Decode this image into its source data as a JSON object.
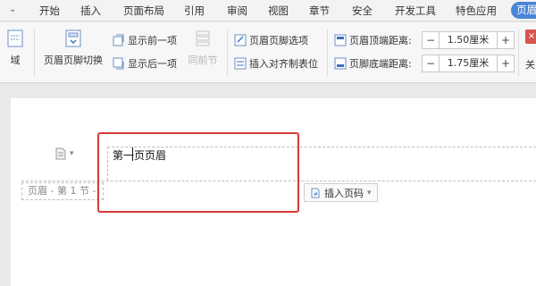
{
  "menubar": {
    "dropdown_icon": "chevron-down-icon",
    "tabs": [
      "开始",
      "插入",
      "页面布局",
      "引用",
      "审阅",
      "视图",
      "章节",
      "安全",
      "开发工具",
      "特色应用"
    ],
    "active_tab": "页眉"
  },
  "ribbon": {
    "field_label": "域",
    "switch_label": "页眉页脚切换",
    "show_prev_label": "显示前一项",
    "show_next_label": "显示后一项",
    "same_prev_label": "同前节",
    "options_label": "页眉页脚选项",
    "insert_align_tab_label": "插入对齐制表位",
    "header_top_label": "页眉顶端距离:",
    "header_top_value": "1.50厘米",
    "footer_bottom_label": "页脚底端距离:",
    "footer_bottom_value": "1.75厘米",
    "minus": "−",
    "plus": "+",
    "close_label": "关"
  },
  "document": {
    "header_text": "第一页页眉",
    "header_tag": "页眉 - 第 1 节 -",
    "insert_page_number_label": "插入页码"
  },
  "colors": {
    "accent": "#4a86d6",
    "highlight": "#d53a3a"
  }
}
